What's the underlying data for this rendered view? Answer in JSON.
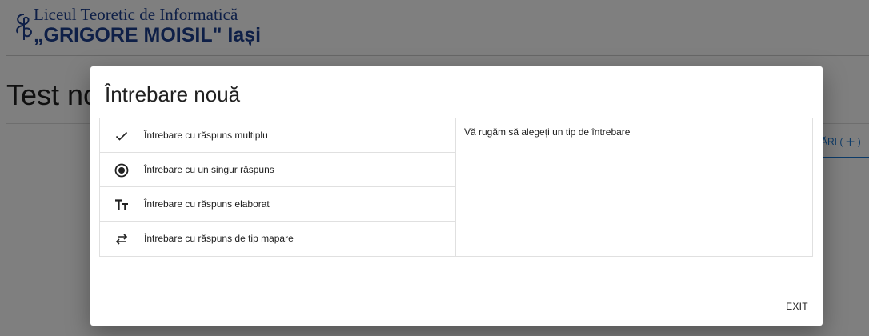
{
  "header": {
    "logo_line1": "Liceul Teoretic de Informatică",
    "logo_line2": "„GRIGORE MOISIL\" Iași"
  },
  "page": {
    "title_visible": "Test no",
    "tab_label": "ĂRI (",
    "tab_plus": "+",
    "tab_close": ")"
  },
  "dialog": {
    "title": "Întrebare nouă",
    "hint": "Vă rugăm să alegeți un tip de întrebare",
    "exit_label": "EXIT",
    "question_types": [
      {
        "icon": "check-icon",
        "label": "Întrebare cu răspuns multiplu"
      },
      {
        "icon": "radio-button-icon",
        "label": "Întrebare cu un singur răspuns"
      },
      {
        "icon": "text-fields-icon",
        "label": "Întrebare cu răspuns elaborat"
      },
      {
        "icon": "swap-arrows-icon",
        "label": "Întrebare cu răspuns de tip mapare"
      }
    ]
  },
  "colors": {
    "brand": "#1c3f8f",
    "accent": "#1976d2",
    "backdrop": "rgba(0,0,0,0.5)"
  }
}
